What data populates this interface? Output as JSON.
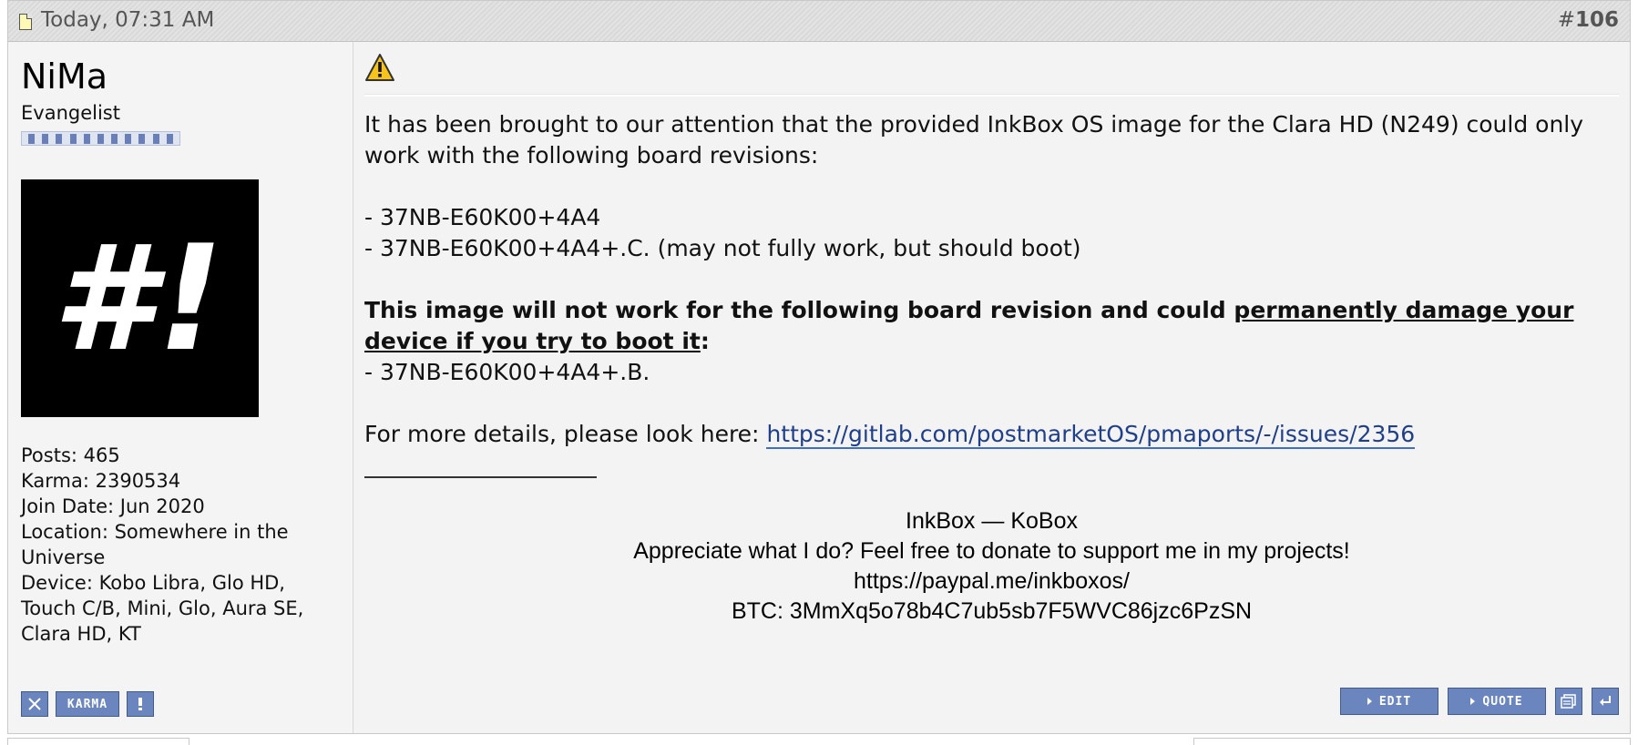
{
  "header": {
    "date": "Today, 07:31 AM",
    "post_number_prefix": "#",
    "post_number": "106"
  },
  "user": {
    "name": "NiMa",
    "title": "Evangelist",
    "avatar_text": "#!",
    "stats": {
      "posts": "Posts: 465",
      "karma": "Karma: 2390534",
      "join_date": "Join Date: Jun 2020",
      "location": "Location: Somewhere in the Universe",
      "device": "Device: Kobo Libra, Glo HD, Touch C/B, Mini, Glo, Aura SE, Clara HD, KT"
    },
    "buttons": {
      "karma_label": "KARMA"
    }
  },
  "post": {
    "intro": "It has been brought to our attention that the provided InkBox OS image for the Clara HD (N249) could only work with the following board revisions:",
    "revision_1": "- 37NB-E60K00+4A4",
    "revision_2": "- 37NB-E60K00+4A4+.C. (may not fully work, but should boot)",
    "warning_bold": "This image will not work for the following board revision and could ",
    "warning_underlined": "permanently damage your device if you try to boot it",
    "warning_colon": ":",
    "bad_revision": "- 37NB-E60K00+4A4+.B.",
    "details_prefix": "For more details, please look here: ",
    "details_link": "https://gitlab.com/postmarketOS/pmaports/-/issues/2356"
  },
  "signature": {
    "line1": "InkBox — KoBox",
    "line2": "Appreciate what I do? Feel free to donate to support me in my projects!",
    "line3": "https://paypal.me/inkboxos/",
    "line4": "BTC: 3MmXq5o78b4C7ub5sb7F5WVC86jzc6PzSN"
  },
  "actions": {
    "edit_label": "EDIT",
    "quote_label": "QUOTE"
  },
  "icons": {
    "post_icon": "document-icon",
    "warning": "warning-icon"
  }
}
